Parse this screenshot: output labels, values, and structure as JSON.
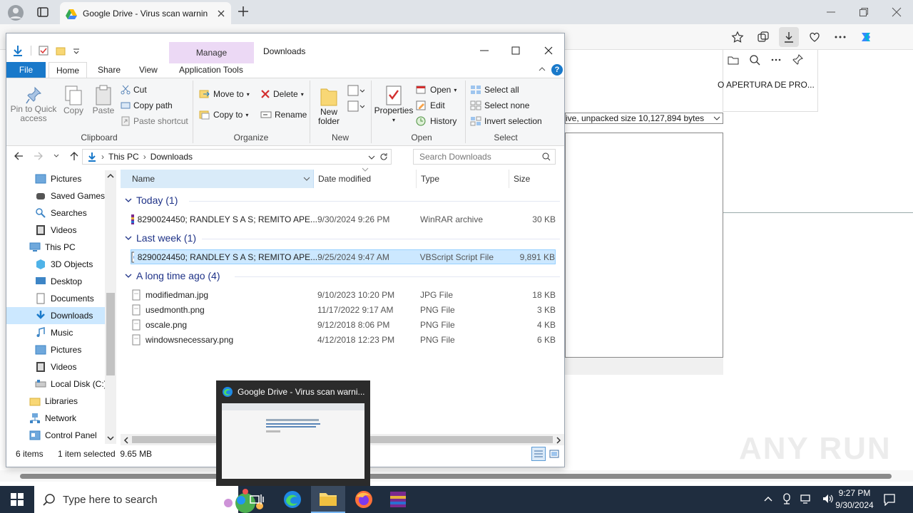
{
  "browser": {
    "tab_title": "Google Drive - Virus scan warnin",
    "page_text_1": "O APERTURA DE PRO...",
    "page_select": "ive, unpacked size 10,127,894 bytes"
  },
  "explorer": {
    "qat_title": "Downloads",
    "manage_tab": "Manage",
    "tabs": [
      "File",
      "Home",
      "Share",
      "View",
      "Application Tools"
    ],
    "clipboard": {
      "pin": "Pin to Quick access",
      "copy": "Copy",
      "paste": "Paste",
      "cut": "Cut",
      "copy_path": "Copy path",
      "paste_shortcut": "Paste shortcut",
      "label": "Clipboard"
    },
    "organize": {
      "move_to": "Move to",
      "copy_to": "Copy to",
      "delete": "Delete",
      "rename": "Rename",
      "label": "Organize"
    },
    "new": {
      "new_folder_1": "New",
      "new_folder_2": "folder",
      "label": "New"
    },
    "open": {
      "properties": "Properties",
      "open": "Open",
      "edit": "Edit",
      "history": "History",
      "label": "Open"
    },
    "select": {
      "select_all": "Select all",
      "select_none": "Select none",
      "invert": "Invert selection",
      "label": "Select"
    },
    "address": {
      "this_pc": "This PC",
      "downloads": "Downloads"
    },
    "search_placeholder": "Search Downloads",
    "nav": [
      "Pictures",
      "Saved Games",
      "Searches",
      "Videos",
      "This PC",
      "3D Objects",
      "Desktop",
      "Documents",
      "Downloads",
      "Music",
      "Pictures",
      "Videos",
      "Local Disk (C:)",
      "Libraries",
      "Network",
      "Control Panel"
    ],
    "columns": {
      "name": "Name",
      "date": "Date modified",
      "type": "Type",
      "size": "Size"
    },
    "groups": {
      "today": "Today (1)",
      "last_week": "Last week (1)",
      "long_ago": "A long time ago (4)"
    },
    "files": [
      {
        "name": "8290024450; RANDLEY S A S; REMITO APE...",
        "date": "9/30/2024 9:26 PM",
        "type": "WinRAR archive",
        "size": "30 KB"
      },
      {
        "name": "8290024450; RANDLEY S A S; REMITO APE...",
        "date": "9/25/2024 9:47 AM",
        "type": "VBScript Script File",
        "size": "9,891 KB"
      },
      {
        "name": "modifiedman.jpg",
        "date": "9/10/2023 10:20 PM",
        "type": "JPG File",
        "size": "18 KB"
      },
      {
        "name": "usedmonth.png",
        "date": "11/17/2022 9:17 AM",
        "type": "PNG File",
        "size": "3 KB"
      },
      {
        "name": "oscale.png",
        "date": "9/12/2018 8:06 PM",
        "type": "PNG File",
        "size": "4 KB"
      },
      {
        "name": "windowsnecessary.png",
        "date": "4/12/2018 12:23 PM",
        "type": "PNG File",
        "size": "6 KB"
      }
    ],
    "status": {
      "items": "6 items",
      "selected": "1 item selected  9.65 MB"
    }
  },
  "thumbnail": {
    "title": "Google Drive - Virus scan warni..."
  },
  "taskbar": {
    "search_placeholder": "Type here to search",
    "time": "9:27 PM",
    "date": "9/30/2024"
  },
  "watermark": "ANY RUN",
  "colors": {
    "accent": "#1979ca",
    "selection": "#cce8ff",
    "taskbar": "#1f2d3f"
  }
}
